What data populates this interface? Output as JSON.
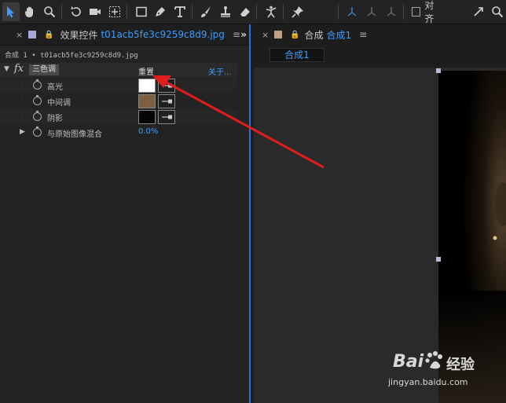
{
  "colors": {
    "accent": "#3e9dff",
    "tab_swatch_left": "#a8a8d8",
    "tab_swatch_right": "#c0a080",
    "highlight_color": "#ffffff",
    "midtone_color": "#7d6040",
    "shadow_color": "#050505",
    "annotation_arrow": "#e01c1c"
  },
  "toolbar": {
    "align_label": "对齐"
  },
  "effects_panel": {
    "title": "效果控件",
    "file_name": "t01acb5fe3c9259c8d9.jpg",
    "layer_path": "合成 1 • t01acb5fe3c9259c8d9.jpg",
    "effect": {
      "fx_label": "fx",
      "name": "三色调",
      "reset_label": "重置",
      "about_label": "关于..."
    },
    "properties": [
      {
        "label": "高光"
      },
      {
        "label": "中间调"
      },
      {
        "label": "阴影"
      },
      {
        "label": "与原始图像混合",
        "value": "0.0%"
      }
    ]
  },
  "composition_panel": {
    "title": "合成",
    "comp_name": "合成1",
    "comp_chip": "合成1"
  },
  "watermark": {
    "brand": "Bai",
    "brand_suffix": "经验",
    "url": "jingyan.baidu.com"
  }
}
